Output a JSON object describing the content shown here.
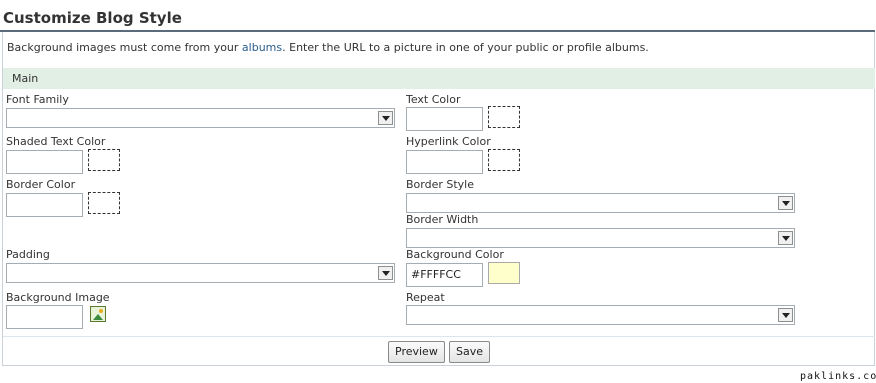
{
  "page": {
    "title": "Customize Blog Style",
    "intro_before": "Background images must come from your ",
    "intro_link": "albums",
    "intro_after": ". Enter the URL to a picture in one of your public or profile albums."
  },
  "section": {
    "title": "Main"
  },
  "fields": {
    "font_family": {
      "label": "Font Family",
      "value": ""
    },
    "text_color": {
      "label": "Text Color",
      "value": ""
    },
    "shaded_text_color": {
      "label": "Shaded Text Color",
      "value": ""
    },
    "hyperlink_color": {
      "label": "Hyperlink Color",
      "value": ""
    },
    "border_color": {
      "label": "Border Color",
      "value": ""
    },
    "border_style": {
      "label": "Border Style",
      "value": ""
    },
    "border_width": {
      "label": "Border Width",
      "value": ""
    },
    "padding": {
      "label": "Padding",
      "value": ""
    },
    "background_color": {
      "label": "Background Color",
      "value": "#FFFFCC",
      "swatch": "#FFFFCC"
    },
    "background_image": {
      "label": "Background Image",
      "value": ""
    },
    "repeat": {
      "label": "Repeat",
      "value": ""
    }
  },
  "buttons": {
    "preview": "Preview",
    "save": "Save"
  },
  "icons": {
    "image_picker": "image-icon",
    "dropdown": "chevron-down-icon"
  },
  "watermark": "paklinks.com",
  "colors": {
    "title_rule": "#5a6b7c",
    "section_bg": "#e2efe5",
    "link": "#2b5f8e"
  }
}
